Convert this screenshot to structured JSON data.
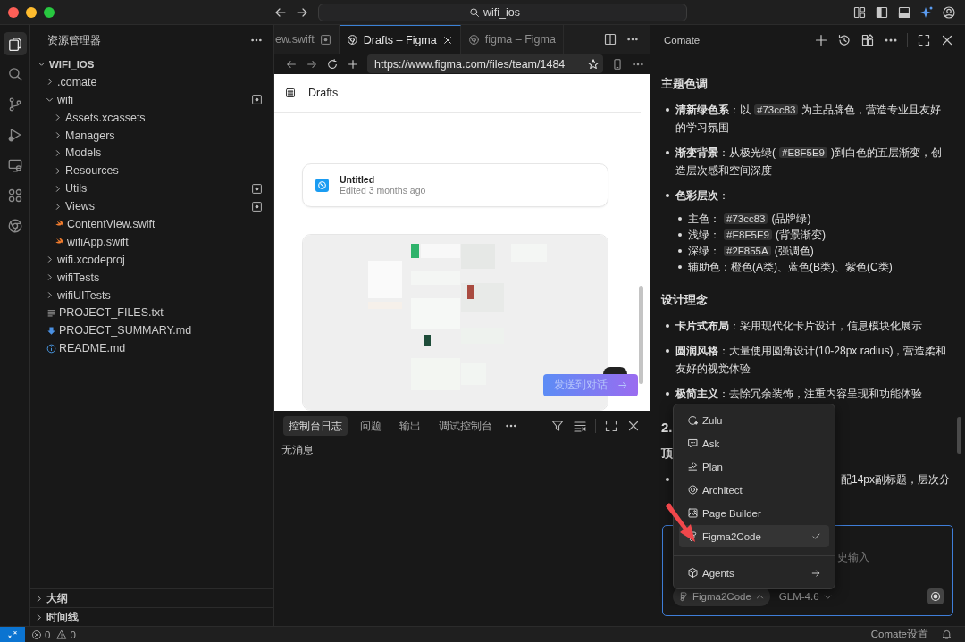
{
  "window": {
    "search": "wifi_ios"
  },
  "activity_bar": [
    {
      "kind": "files",
      "selected": true
    },
    {
      "kind": "search",
      "selected": false
    },
    {
      "kind": "source-control",
      "selected": false
    },
    {
      "kind": "run",
      "selected": false
    },
    {
      "kind": "remote",
      "selected": false
    },
    {
      "kind": "extensions",
      "selected": false
    },
    {
      "kind": "browser",
      "selected": false
    }
  ],
  "explorer": {
    "title": "资源管理器",
    "tree": [
      {
        "name": "WIFI_IOS",
        "kind": "folder",
        "expanded": true,
        "modified": false,
        "children": [
          {
            "name": ".comate",
            "kind": "folder",
            "expanded": false,
            "modified": false
          },
          {
            "name": "wifi",
            "kind": "folder",
            "expanded": true,
            "modified": true,
            "children": [
              {
                "name": "Assets.xcassets",
                "kind": "folder",
                "expanded": false,
                "modified": false
              },
              {
                "name": "Managers",
                "kind": "folder",
                "expanded": false,
                "modified": false
              },
              {
                "name": "Models",
                "kind": "folder",
                "expanded": false,
                "modified": false
              },
              {
                "name": "Resources",
                "kind": "folder",
                "expanded": false,
                "modified": false
              },
              {
                "name": "Utils",
                "kind": "folder",
                "expanded": false,
                "modified": true
              },
              {
                "name": "Views",
                "kind": "folder",
                "expanded": false,
                "modified": true
              },
              {
                "name": "ContentView.swift",
                "kind": "swift",
                "modified": false
              },
              {
                "name": "wifiApp.swift",
                "kind": "swift",
                "modified": false
              }
            ]
          },
          {
            "name": "wifi.xcodeproj",
            "kind": "folder",
            "expanded": false,
            "modified": false
          },
          {
            "name": "wifiTests",
            "kind": "folder",
            "expanded": false,
            "modified": false
          },
          {
            "name": "wifiUITests",
            "kind": "folder",
            "expanded": false,
            "modified": false
          },
          {
            "name": "PROJECT_FILES.txt",
            "kind": "txt",
            "modified": false
          },
          {
            "name": "PROJECT_SUMMARY.md",
            "kind": "md",
            "modified": false
          },
          {
            "name": "README.md",
            "kind": "readme",
            "modified": false
          }
        ]
      }
    ],
    "sections": [
      {
        "label": "大纲",
        "expanded": false
      },
      {
        "label": "时间线",
        "expanded": false
      }
    ]
  },
  "editor_tabs": [
    {
      "label": "ew.swift",
      "kind": "file",
      "selected": false,
      "modified": true
    },
    {
      "label": "Drafts – Figma",
      "kind": "web",
      "selected": true,
      "modified": false
    },
    {
      "label": "figma – Figma",
      "kind": "web",
      "selected": false,
      "modified": false
    }
  ],
  "browser": {
    "url": "https://www.figma.com/files/team/1484",
    "page_title": "Drafts",
    "files": [
      {
        "title": "Untitled",
        "subtitle": "Edited 3 months ago"
      }
    ],
    "send_button": "发送到对话"
  },
  "panel": {
    "tabs": [
      {
        "label": "控制台日志",
        "selected": true
      },
      {
        "label": "问题",
        "selected": false
      },
      {
        "label": "输出",
        "selected": false
      },
      {
        "label": "调试控制台",
        "selected": false
      }
    ],
    "message": "无消息"
  },
  "chat": {
    "title": "Comate",
    "blocks": [
      {
        "kind": "heading",
        "text": "主题色调"
      },
      {
        "kind": "bullet",
        "segments": [
          {
            "kind": "text",
            "text": "**清新绿色系**：以"
          },
          {
            "kind": "code",
            "text": "#73cc83"
          },
          {
            "kind": "text",
            "text": "为主品牌色，营造专业且友好的学习氛围"
          }
        ]
      },
      {
        "kind": "bullet",
        "segments": [
          {
            "kind": "text",
            "text": "**渐变背景**：从极光绿("
          },
          {
            "kind": "code",
            "text": "#E8F5E9"
          },
          {
            "kind": "text",
            "text": ")到白色的五层渐变，创造层次感和空间深度"
          }
        ]
      },
      {
        "kind": "bullet",
        "segments": [
          {
            "kind": "text",
            "text": "**色彩层次**："
          }
        ]
      },
      {
        "kind": "sub-list",
        "items": [
          {
            "segments": [
              {
                "kind": "text",
                "text": "主色："
              },
              {
                "kind": "code",
                "text": "#73cc83"
              },
              {
                "kind": "text",
                "text": "(品牌绿)"
              }
            ]
          },
          {
            "segments": [
              {
                "kind": "text",
                "text": "浅绿："
              },
              {
                "kind": "code",
                "text": "#E8F5E9"
              },
              {
                "kind": "text",
                "text": "(背景渐变)"
              }
            ]
          },
          {
            "segments": [
              {
                "kind": "text",
                "text": "深绿："
              },
              {
                "kind": "code",
                "text": "#2F855A"
              },
              {
                "kind": "text",
                "text": "(强调色)"
              }
            ]
          },
          {
            "segments": [
              {
                "kind": "text",
                "text": "辅助色：橙色(A类)、蓝色(B类)、紫色(C类)"
              }
            ]
          }
        ]
      },
      {
        "kind": "heading",
        "text": "设计理念"
      },
      {
        "kind": "bullet",
        "segments": [
          {
            "kind": "text",
            "text": "**卡片式布局**：采用现代化卡片设计，信息模块化展示"
          }
        ]
      },
      {
        "kind": "bullet",
        "segments": [
          {
            "kind": "text",
            "text": "**圆润风格**：大量使用圆角设计(10-28px radius)，营造柔和友好的视觉体验"
          }
        ]
      },
      {
        "kind": "bullet",
        "segments": [
          {
            "kind": "text",
            "text": "**极简主义**：去除冗余装饰，注重内容呈现和功能体验"
          }
        ]
      },
      {
        "kind": "number-heading",
        "text": "2."
      },
      {
        "kind": "heading",
        "text": "顶"
      },
      {
        "kind": "covered-bullet",
        "segments": [
          {
            "kind": "text",
            "text": "配14px副标题，层次分"
          }
        ]
      }
    ],
    "input": {
      "placeholder": "史输入",
      "mode": "Figma2Code",
      "model": "GLM-4.6"
    },
    "menu": [
      {
        "label": "Zulu",
        "kind": "zulu",
        "selected": false
      },
      {
        "label": "Ask",
        "kind": "ask",
        "selected": false
      },
      {
        "label": "Plan",
        "kind": "plan",
        "selected": false
      },
      {
        "label": "Architect",
        "kind": "architect",
        "selected": false
      },
      {
        "label": "Page Builder",
        "kind": "page-builder",
        "selected": false
      },
      {
        "label": "Figma2Code",
        "kind": "figma",
        "selected": true
      },
      {
        "label": "Agents",
        "kind": "agents",
        "selected": false
      }
    ]
  },
  "status_bar": {
    "errors": "0",
    "warnings": "0",
    "settings": "Comate设置"
  }
}
